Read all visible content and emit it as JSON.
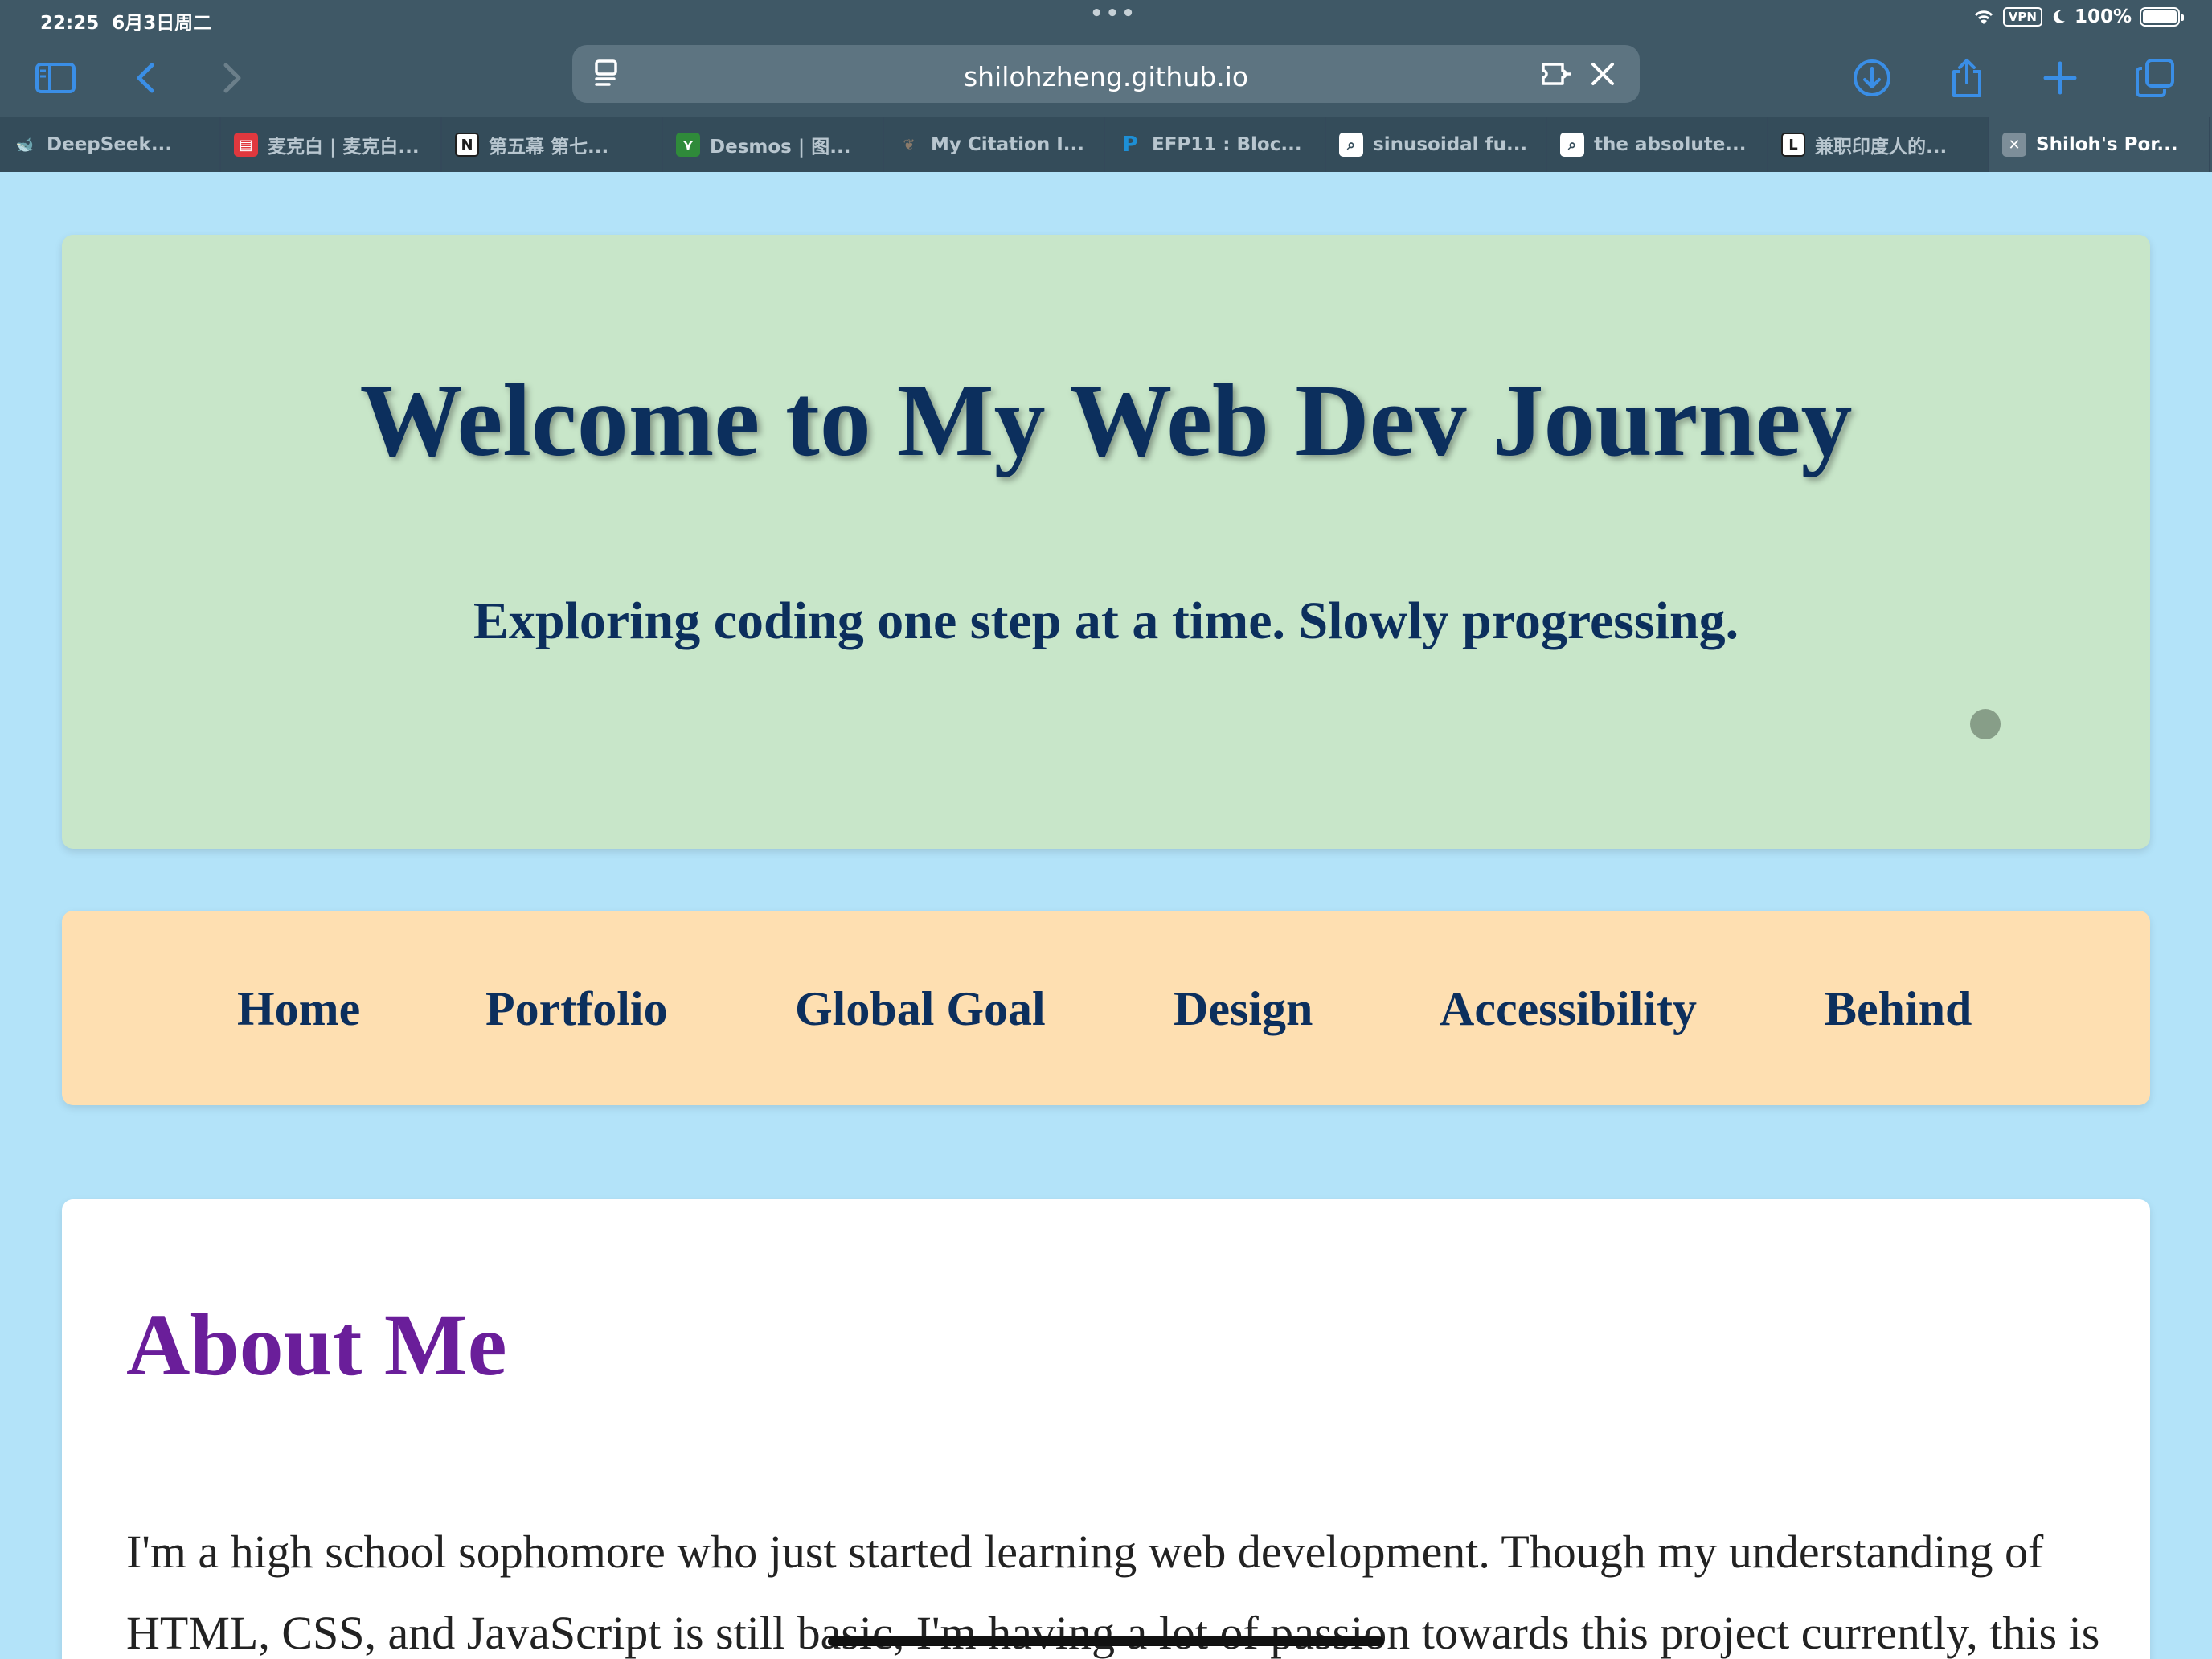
{
  "status": {
    "time": "22:25",
    "date": "6月3日周二",
    "vpn": "VPN",
    "battery": "100%"
  },
  "toolbar": {
    "url": "shilohzheng.github.io",
    "icons": [
      "sidebar-icon",
      "back-icon",
      "forward-icon",
      "reader-icon",
      "extension-icon",
      "close-icon",
      "download-icon",
      "share-icon",
      "new-tab-icon",
      "tabs-overview-icon"
    ]
  },
  "tabs": [
    {
      "label": "DeepSeek...",
      "icon": "whale",
      "color": "#4d6bfe"
    },
    {
      "label": "麦克白 | 麦克白...",
      "icon": "book",
      "color": "#e0383e"
    },
    {
      "label": "第五幕 第七...",
      "icon": "N",
      "color": "#1f1f1f"
    },
    {
      "label": "Desmos | 图...",
      "icon": "graph",
      "color": "#2f8a3a"
    },
    {
      "label": "My Citation I...",
      "icon": "squirrel",
      "color": "#8a7a6a"
    },
    {
      "label": "EFP11 : Bloc...",
      "icon": "P",
      "color": "#1d8fd6"
    },
    {
      "label": "sinusoidal fu...",
      "icon": "search",
      "color": "#ffffff"
    },
    {
      "label": "the absolute...",
      "icon": "search",
      "color": "#ffffff"
    },
    {
      "label": "兼职印度人的...",
      "icon": "L",
      "color": "#1f1f1f"
    },
    {
      "label": "Shiloh's Por...",
      "icon": "x",
      "color": "#7d8e99"
    }
  ],
  "hero": {
    "title": "Welcome to My Web Dev Journey",
    "subtitle": "Exploring coding one step at a time. Slowly progressing."
  },
  "nav": {
    "items": [
      "Home",
      "Portfolio",
      "Global Goal",
      "Design",
      "Accessibility",
      "Behind"
    ]
  },
  "about": {
    "title": "About Me",
    "text": "I'm a high school sophomore who just started learning web development. Though my understanding of HTML, CSS, and JavaScript is still basic, I'm having a lot of passion towards this project currently, this is"
  },
  "colors": {
    "page_bg": "#b3e3f9",
    "hero_bg": "#c8e6c9",
    "nav_bg": "#fedfb1",
    "heading_navy": "#0c2f5d",
    "about_purple": "#6a1e9a",
    "chrome_bg": "#3f5866"
  }
}
